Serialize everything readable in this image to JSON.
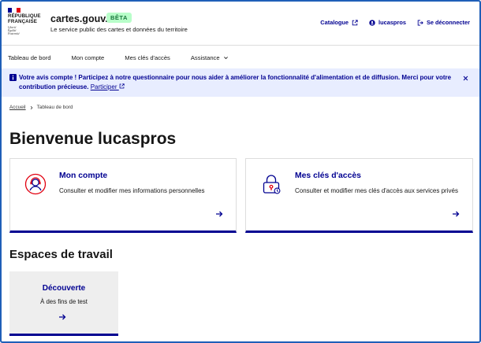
{
  "brand": {
    "flag_colors": [
      "#000091",
      "#ffffff",
      "#e1000f"
    ],
    "republic_line1": "RÉPUBLIQUE",
    "republic_line2": "FRANÇAISE",
    "motto_1": "Liberté",
    "motto_2": "Égalité",
    "motto_3": "Fraternité",
    "site_name": "cartes.gouv.fr",
    "badge": "BÊTA",
    "tagline": "Le service public des cartes et données du territoire"
  },
  "top_links": {
    "catalogue": "Catalogue",
    "user": "lucaspros",
    "logout": "Se déconnecter"
  },
  "nav": {
    "dashboard": "Tableau de bord",
    "account": "Mon compte",
    "keys": "Mes clés d'accès",
    "help": "Assistance"
  },
  "notice": {
    "text": "Votre avis compte ! Participez à notre questionnaire pour nous aider à améliorer la fonctionnalité d'alimentation et de diffusion. Merci pour votre contribution précieuse.",
    "link": "Participer"
  },
  "breadcrumb": {
    "home": "Accueil",
    "current": "Tableau de bord"
  },
  "page_title": "Bienvenue lucaspros",
  "cards": {
    "account": {
      "title": "Mon compte",
      "desc": "Consulter et modifier mes informations personnelles"
    },
    "keys": {
      "title": "Mes clés d'accès",
      "desc": "Consulter et modifier mes clés d'accès aux services privés"
    }
  },
  "workspaces": {
    "title": "Espaces de travail",
    "tile": {
      "title": "Découverte",
      "desc": "À des fins de test"
    }
  },
  "colors": {
    "primary": "#000091",
    "notice_bg": "#e8edff",
    "badge_bg": "#b8fec9",
    "badge_fg": "#18753c",
    "accent_red": "#e1000f"
  }
}
